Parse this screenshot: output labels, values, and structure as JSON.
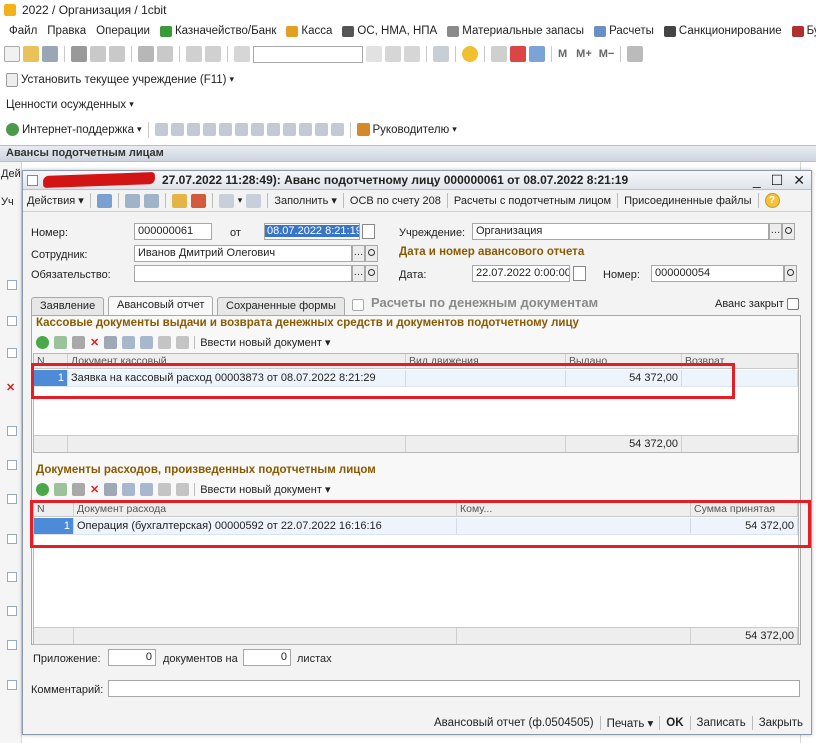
{
  "app": {
    "title": "2022 / Организация / 1cbit"
  },
  "menu": [
    "Файл",
    "Правка",
    "Операции",
    "Казначейство/Банк",
    "Касса",
    "ОС, НМА, НПА",
    "Материальные запасы",
    "Расчеты",
    "Санкционирование",
    "Бухгалтер"
  ],
  "panels": {
    "set_institution": "Установить текущее учреждение (F11)",
    "valuables": "Ценности осужденных",
    "internet_support": "Интернет-поддержка",
    "manager": "Руководителю"
  },
  "list_caption": "Авансы подотчетным лицам",
  "bg_labels": {
    "dei": "Дей",
    "uch": "Уч"
  },
  "window": {
    "title": "27.07.2022 11:28:49): Аванс подотчетному лицу 000000061 от 08.07.2022 8:21:19",
    "toolbar": {
      "actions": "Действия",
      "fill": "Заполнить",
      "osv": "ОСВ по счету 208",
      "settlements": "Расчеты с подотчетным лицом",
      "attached": "Присоединенные файлы"
    },
    "form": {
      "number_label": "Номер:",
      "number_value": "000000061",
      "from_label": "от",
      "date_value": "08.07.2022  8:21:19",
      "institution_label": "Учреждение:",
      "institution_value": "Организация",
      "employee_label": "Сотрудник:",
      "employee_value": "Иванов Дмитрий Олегович",
      "report_head": "Дата и номер авансового отчета",
      "obligation_label": "Обязательство:",
      "obligation_value": "",
      "report_date_label": "Дата:",
      "report_date_value": "22.07.2022  0:00:00",
      "report_number_label": "Номер:",
      "report_number_value": "000000054"
    },
    "tabs": {
      "statement": "Заявление",
      "advance_report": "Авансовый отчет",
      "saved_forms": "Сохраненные формы",
      "money_docs": "Расчеты по денежным документам",
      "advance_closed": "Аванс закрыт"
    },
    "cash_section": {
      "title": "Кассовые документы выдачи и возврата денежных средств и документов подотчетному лицу",
      "enter_new": "Ввести новый документ",
      "headers": [
        "N",
        "Документ кассовый",
        "Вид движения",
        "Выдано",
        "Возврат"
      ],
      "rows": [
        {
          "n": "1",
          "doc": "Заявка на кассовый расход 00003873 от 08.07.2022 8:21:29",
          "kind": "",
          "issued": "54 372,00",
          "returned": ""
        }
      ],
      "total_issued": "54 372,00"
    },
    "expense_section": {
      "title": "Документы расходов, произведенных подотчетным лицом",
      "enter_new": "Ввести новый документ",
      "headers": [
        "N",
        "Документ расхода",
        "Кому...",
        "Сумма принятая"
      ],
      "rows": [
        {
          "n": "1",
          "doc": "Операция (бухгалтерская) 00000592 от 22.07.2022 16:16:16",
          "to": "",
          "amount": "54 372,00"
        }
      ],
      "total_amount": "54 372,00"
    },
    "attachment": {
      "label": "Приложение:",
      "docs_value": "0",
      "docs_label": "документов на",
      "sheets_value": "0",
      "sheets_label": "листах"
    },
    "comment_label": "Комментарий:",
    "comment_value": "",
    "bottom": {
      "report": "Авансовый отчет (ф.0504505)",
      "print": "Печать",
      "ok": "OK",
      "save": "Записать",
      "close": "Закрыть"
    }
  }
}
